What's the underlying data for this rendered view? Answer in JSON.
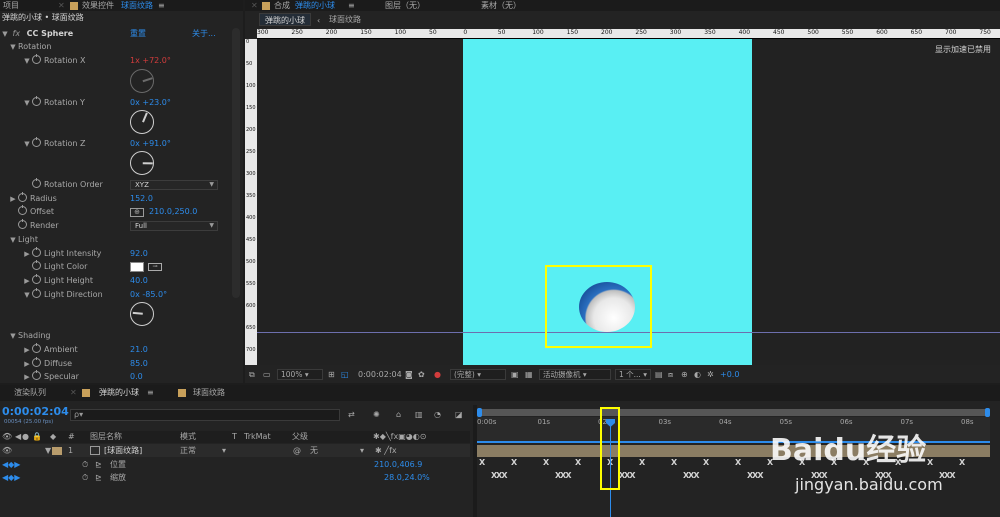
{
  "effect_controls": {
    "tabs": [
      "项目",
      "效果控件",
      "球面纹路"
    ],
    "breadcrumb": "弹跳的小球 • 球面纹路",
    "fx_name": "CC Sphere",
    "reset": "重置",
    "about": "关于...",
    "props": {
      "rotation": "Rotation",
      "rotation_x_label": "Rotation X",
      "rotation_x_rev": "1x",
      "rotation_x_val": "+72.0°",
      "rotation_y_label": "Rotation Y",
      "rotation_y_val": "0x +23.0°",
      "rotation_z_label": "Rotation Z",
      "rotation_z_val": "0x +91.0°",
      "rotation_order_label": "Rotation Order",
      "rotation_order_val": "XYZ",
      "radius_label": "Radius",
      "radius_val": "152.0",
      "offset_label": "Offset",
      "offset_val": "210.0,250.0",
      "render_label": "Render",
      "render_val": "Full",
      "light": "Light",
      "light_intensity_label": "Light Intensity",
      "light_intensity_val": "92.0",
      "light_color_label": "Light Color",
      "light_height_label": "Light Height",
      "light_height_val": "40.0",
      "light_direction_label": "Light Direction",
      "light_direction_val": "0x -85.0°",
      "shading": "Shading",
      "ambient_label": "Ambient",
      "ambient_val": "21.0",
      "diffuse_label": "Diffuse",
      "diffuse_val": "85.0",
      "specular_label": "Specular",
      "specular_val": "0.0"
    }
  },
  "composition": {
    "tabs": [
      "合成",
      "弹跳的小球",
      "图层（无）",
      "素材（无）"
    ],
    "subtabs": [
      "弹跳的小球",
      "球面纹路"
    ],
    "gpu_text": "显示加速已禁用",
    "ruler_h": [
      "300",
      "250",
      "200",
      "150",
      "100",
      "50",
      "0",
      "50",
      "100",
      "150",
      "200",
      "250",
      "300",
      "350",
      "400",
      "450",
      "500",
      "550",
      "600",
      "650",
      "700",
      "750"
    ],
    "ruler_v": [
      "0",
      "50",
      "100",
      "150",
      "200",
      "250",
      "300",
      "350",
      "400",
      "450",
      "500",
      "550",
      "600",
      "650",
      "700"
    ],
    "toolbar": {
      "zoom": "100%",
      "timecode": "0:00:02:04",
      "quality": "(完整)",
      "camera": "活动摄像机",
      "views": "1 个...",
      "exposure": "+0.0"
    },
    "canvas_color": "#59eff3"
  },
  "timeline": {
    "tabs": [
      "渲染队列",
      "弹跳的小球",
      "球面纹路"
    ],
    "timecode": "0:00:02:04",
    "fps": "00054 (25.00 fps)",
    "search_placeholder": "ρ▾",
    "columns": {
      "layer_name": "图层名称",
      "mode": "模式",
      "t": "T",
      "trkmat": "TrkMat",
      "parent": "父级"
    },
    "layer": {
      "index": "1",
      "name": "[球面纹路]",
      "mode": "正常",
      "parent": "无"
    },
    "props": [
      {
        "name": "位置",
        "value": "210.0,406.9"
      },
      {
        "name": "缩放",
        "value": "28.0,24.0%"
      }
    ],
    "time_labels": [
      "0:00s",
      "01s",
      "02s",
      "03s",
      "04s",
      "05s",
      "06s",
      "07s",
      "08s"
    ]
  },
  "watermark": {
    "text": "Baidu经验",
    "url": "jingyan.baidu.com"
  }
}
